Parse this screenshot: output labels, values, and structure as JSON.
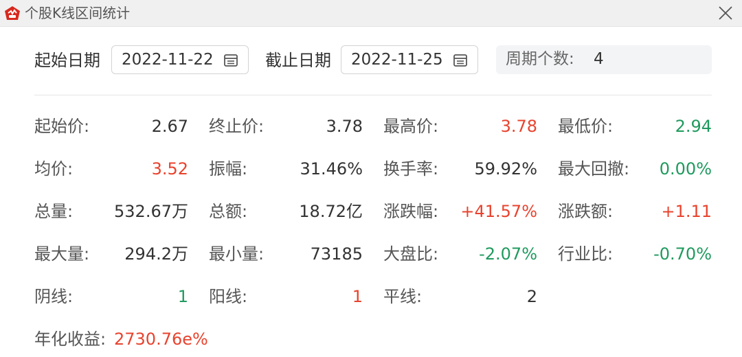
{
  "window": {
    "title": "个股K线区间统计"
  },
  "date_range": {
    "start_label": "起始日期",
    "start_value": "2022-11-22",
    "end_label": "截止日期",
    "end_value": "2022-11-25",
    "period_label": "周期个数:",
    "period_value": "4"
  },
  "stats": {
    "r1": {
      "c1": {
        "label": "起始价:",
        "value": "2.67"
      },
      "c2": {
        "label": "终止价:",
        "value": "3.78"
      },
      "c3": {
        "label": "最高价:",
        "value": "3.78"
      },
      "c4": {
        "label": "最低价:",
        "value": "2.94"
      }
    },
    "r2": {
      "c1": {
        "label": "均价:",
        "value": "3.52"
      },
      "c2": {
        "label": "振幅:",
        "value": "31.46%"
      },
      "c3": {
        "label": "换手率:",
        "value": "59.92%"
      },
      "c4": {
        "label": "最大回撤:",
        "value": "0.00%"
      }
    },
    "r3": {
      "c1": {
        "label": "总量:",
        "value": "532.67万"
      },
      "c2": {
        "label": "总额:",
        "value": "18.72亿"
      },
      "c3": {
        "label": "涨跌幅:",
        "value": "+41.57%"
      },
      "c4": {
        "label": "涨跌额:",
        "value": "+1.11"
      }
    },
    "r4": {
      "c1": {
        "label": "最大量:",
        "value": "294.2万"
      },
      "c2": {
        "label": "最小量:",
        "value": "73185"
      },
      "c3": {
        "label": "大盘比:",
        "value": "-2.07%"
      },
      "c4": {
        "label": "行业比:",
        "value": "-0.70%"
      }
    },
    "r5": {
      "c1": {
        "label": "阴线:",
        "value": "1"
      },
      "c2": {
        "label": "阳线:",
        "value": "1"
      },
      "c3": {
        "label": "平线:",
        "value": "2"
      }
    },
    "annualized": {
      "label": "年化收益:",
      "value": "2730.76e%"
    }
  },
  "colors": {
    "up": "#e8432e",
    "down": "#1f9a5e",
    "text": "#333333"
  },
  "icons": {
    "app": "app-logo-icon",
    "close": "close-icon",
    "calendar": "calendar-icon"
  }
}
